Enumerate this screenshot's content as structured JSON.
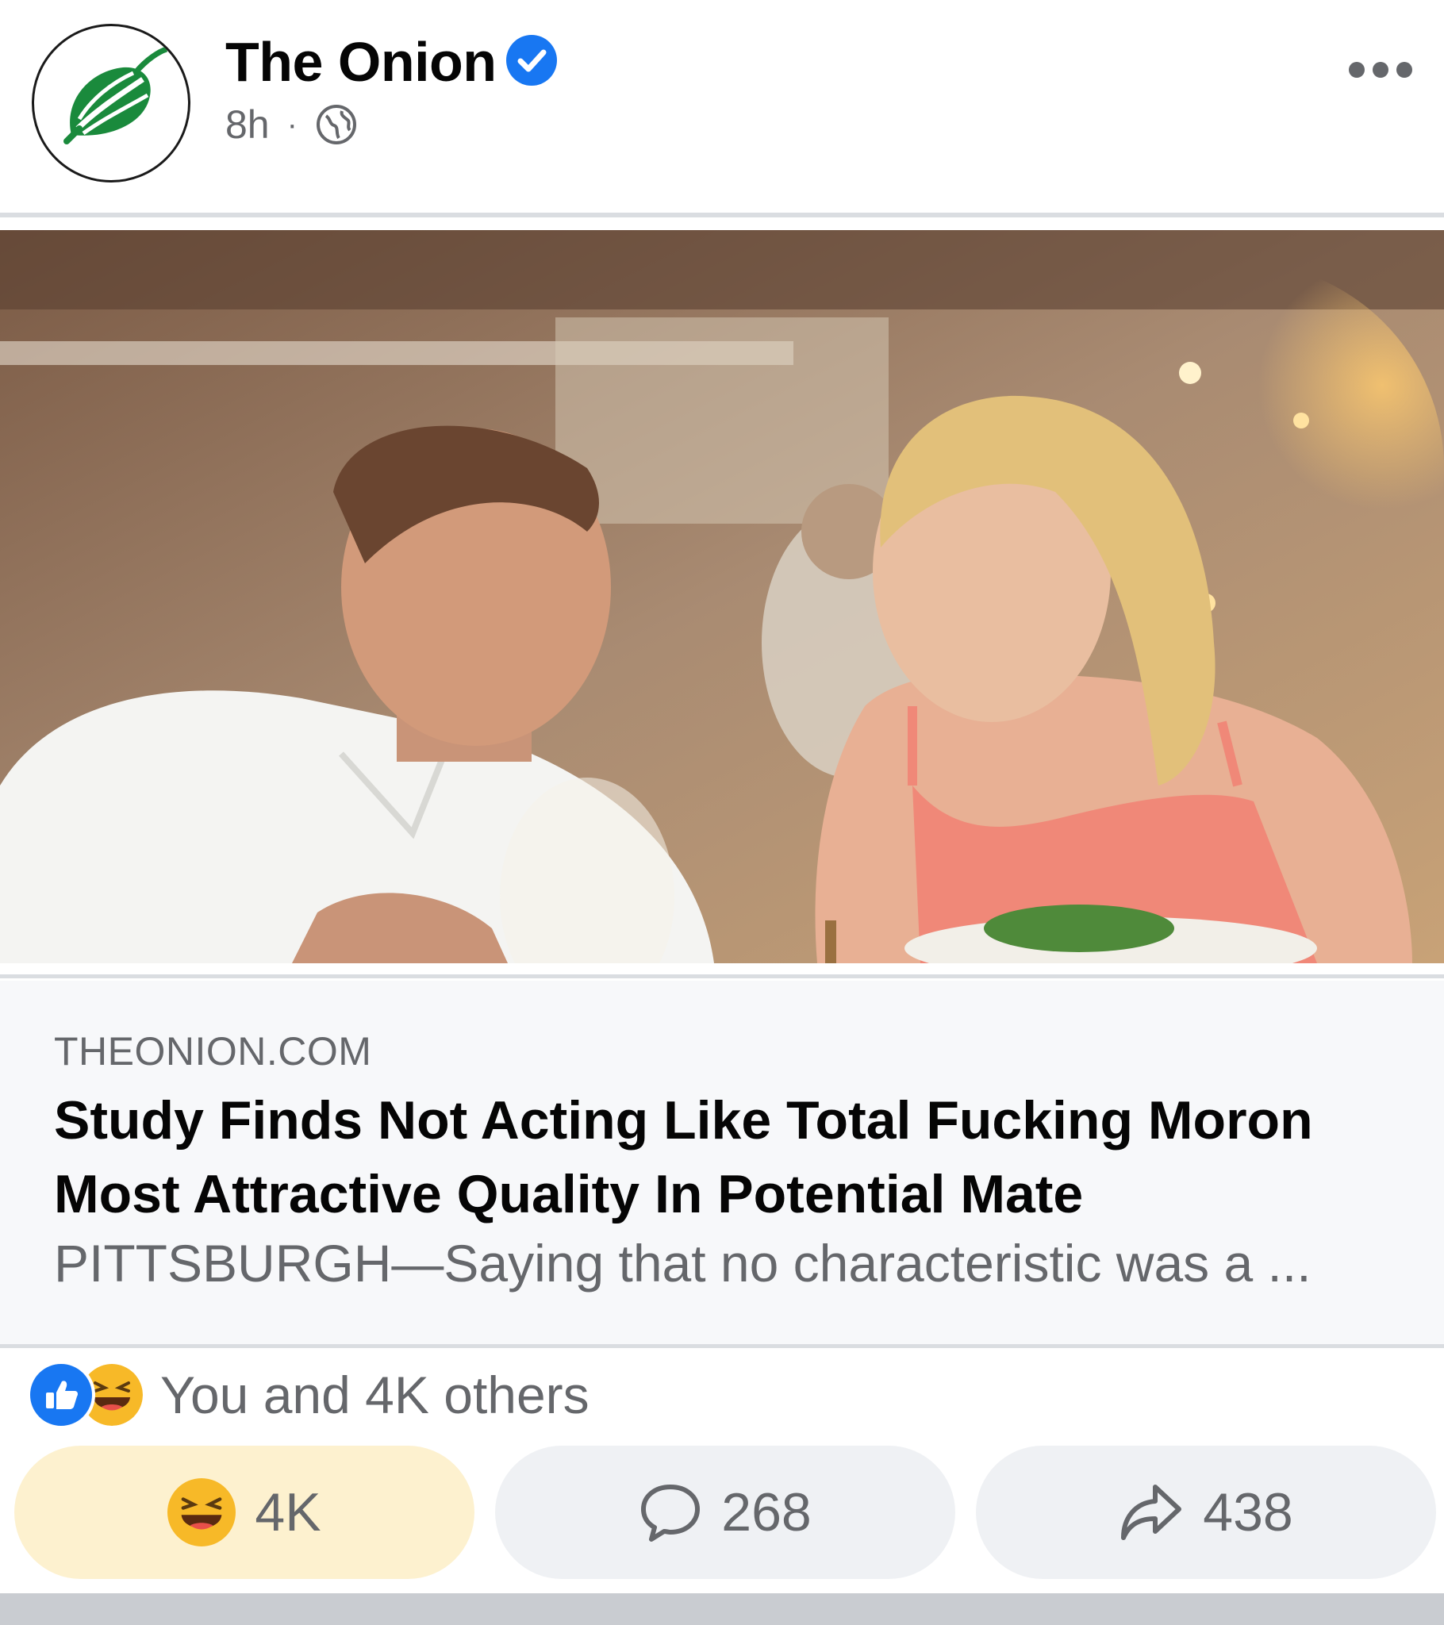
{
  "header": {
    "page_name": "The Onion",
    "timestamp": "8h",
    "separator": "·",
    "audience_icon": "globe-icon",
    "verified_icon": "verified-badge-icon",
    "more_icon": "more-options-icon"
  },
  "link_preview": {
    "domain": "THEONION.COM",
    "headline": "Study Finds Not Acting Like Total Fucking Moron Most Attractive Quality In Potential Mate",
    "description": "PITTSBURGH—Saying that no characteristic was a ..."
  },
  "reactions": {
    "summary_text": "You and 4K others",
    "icons": [
      "like-icon",
      "haha-icon"
    ]
  },
  "actions": {
    "reaction_count": "4K",
    "comment_count": "268",
    "share_count": "438"
  },
  "colors": {
    "accent": "#1877f2",
    "react_button_bg": "#fdf1cf",
    "onion_green": "#1a8a3c"
  }
}
